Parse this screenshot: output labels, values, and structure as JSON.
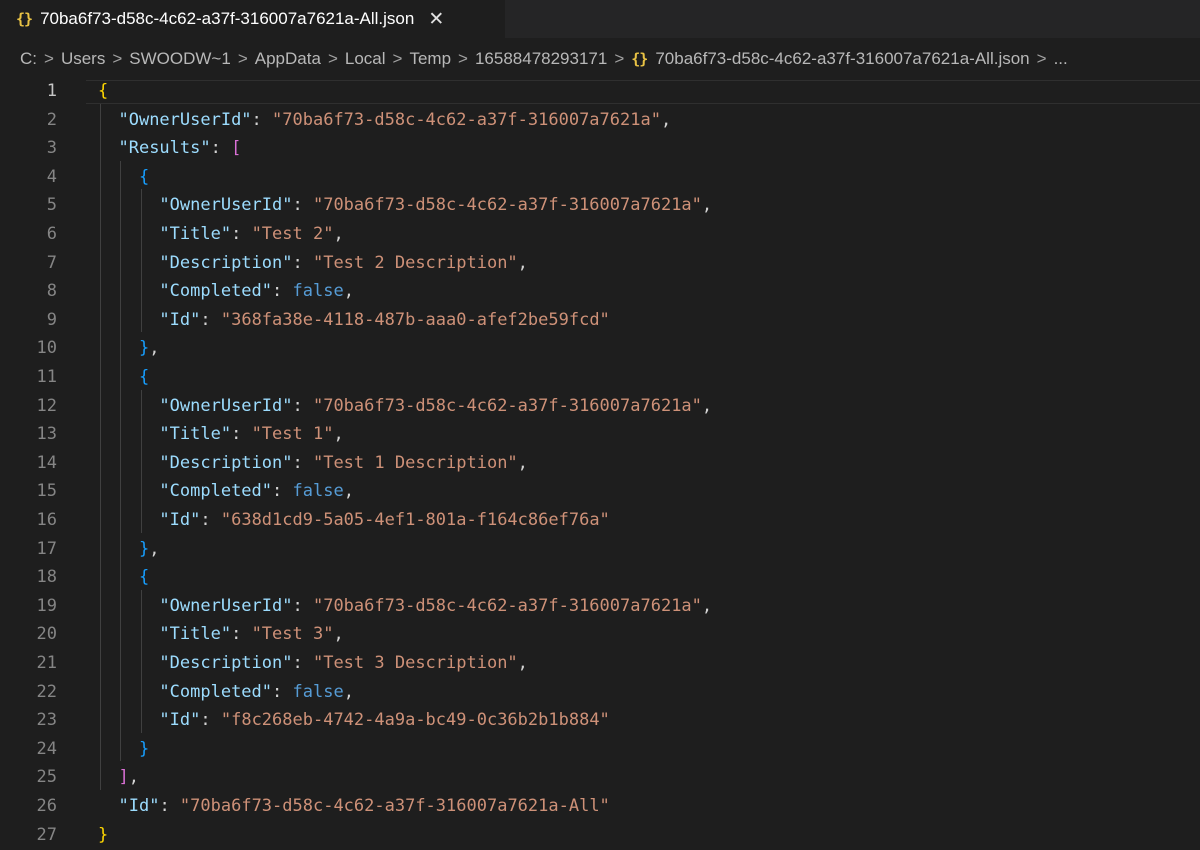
{
  "tab": {
    "icon": "{}",
    "label": "70ba6f73-d58c-4c62-a37f-316007a7621a-All.json",
    "close": "✕"
  },
  "breadcrumb": {
    "parts": [
      "C:",
      "Users",
      "SWOODW~1",
      "AppData",
      "Local",
      "Temp",
      "16588478293171"
    ],
    "file_icon": "{}",
    "file": "70ba6f73-d58c-4c62-a37f-316007a7621a-All.json",
    "ellipsis": "...",
    "separator": ">"
  },
  "editor": {
    "active_line": 1,
    "lines": [
      {
        "n": "1",
        "tokens": [
          {
            "t": "{",
            "c": "br1"
          }
        ]
      },
      {
        "n": "2",
        "tokens": [
          {
            "t": "  "
          },
          {
            "t": "\"OwnerUserId\"",
            "c": "k"
          },
          {
            "t": ": ",
            "c": "p"
          },
          {
            "t": "\"70ba6f73-d58c-4c62-a37f-316007a7621a\"",
            "c": "s"
          },
          {
            "t": ",",
            "c": "p"
          }
        ]
      },
      {
        "n": "3",
        "tokens": [
          {
            "t": "  "
          },
          {
            "t": "\"Results\"",
            "c": "k"
          },
          {
            "t": ": ",
            "c": "p"
          },
          {
            "t": "[",
            "c": "br2"
          }
        ]
      },
      {
        "n": "4",
        "tokens": [
          {
            "t": "    "
          },
          {
            "t": "{",
            "c": "br3"
          }
        ]
      },
      {
        "n": "5",
        "tokens": [
          {
            "t": "      "
          },
          {
            "t": "\"OwnerUserId\"",
            "c": "k"
          },
          {
            "t": ": ",
            "c": "p"
          },
          {
            "t": "\"70ba6f73-d58c-4c62-a37f-316007a7621a\"",
            "c": "s"
          },
          {
            "t": ",",
            "c": "p"
          }
        ]
      },
      {
        "n": "6",
        "tokens": [
          {
            "t": "      "
          },
          {
            "t": "\"Title\"",
            "c": "k"
          },
          {
            "t": ": ",
            "c": "p"
          },
          {
            "t": "\"Test 2\"",
            "c": "s"
          },
          {
            "t": ",",
            "c": "p"
          }
        ]
      },
      {
        "n": "7",
        "tokens": [
          {
            "t": "      "
          },
          {
            "t": "\"Description\"",
            "c": "k"
          },
          {
            "t": ": ",
            "c": "p"
          },
          {
            "t": "\"Test 2 Description\"",
            "c": "s"
          },
          {
            "t": ",",
            "c": "p"
          }
        ]
      },
      {
        "n": "8",
        "tokens": [
          {
            "t": "      "
          },
          {
            "t": "\"Completed\"",
            "c": "k"
          },
          {
            "t": ": ",
            "c": "p"
          },
          {
            "t": "false",
            "c": "b"
          },
          {
            "t": ",",
            "c": "p"
          }
        ]
      },
      {
        "n": "9",
        "tokens": [
          {
            "t": "      "
          },
          {
            "t": "\"Id\"",
            "c": "k"
          },
          {
            "t": ": ",
            "c": "p"
          },
          {
            "t": "\"368fa38e-4118-487b-aaa0-afef2be59fcd\"",
            "c": "s"
          }
        ]
      },
      {
        "n": "10",
        "tokens": [
          {
            "t": "    "
          },
          {
            "t": "}",
            "c": "br3"
          },
          {
            "t": ",",
            "c": "p"
          }
        ]
      },
      {
        "n": "11",
        "tokens": [
          {
            "t": "    "
          },
          {
            "t": "{",
            "c": "br3"
          }
        ]
      },
      {
        "n": "12",
        "tokens": [
          {
            "t": "      "
          },
          {
            "t": "\"OwnerUserId\"",
            "c": "k"
          },
          {
            "t": ": ",
            "c": "p"
          },
          {
            "t": "\"70ba6f73-d58c-4c62-a37f-316007a7621a\"",
            "c": "s"
          },
          {
            "t": ",",
            "c": "p"
          }
        ]
      },
      {
        "n": "13",
        "tokens": [
          {
            "t": "      "
          },
          {
            "t": "\"Title\"",
            "c": "k"
          },
          {
            "t": ": ",
            "c": "p"
          },
          {
            "t": "\"Test 1\"",
            "c": "s"
          },
          {
            "t": ",",
            "c": "p"
          }
        ]
      },
      {
        "n": "14",
        "tokens": [
          {
            "t": "      "
          },
          {
            "t": "\"Description\"",
            "c": "k"
          },
          {
            "t": ": ",
            "c": "p"
          },
          {
            "t": "\"Test 1 Description\"",
            "c": "s"
          },
          {
            "t": ",",
            "c": "p"
          }
        ]
      },
      {
        "n": "15",
        "tokens": [
          {
            "t": "      "
          },
          {
            "t": "\"Completed\"",
            "c": "k"
          },
          {
            "t": ": ",
            "c": "p"
          },
          {
            "t": "false",
            "c": "b"
          },
          {
            "t": ",",
            "c": "p"
          }
        ]
      },
      {
        "n": "16",
        "tokens": [
          {
            "t": "      "
          },
          {
            "t": "\"Id\"",
            "c": "k"
          },
          {
            "t": ": ",
            "c": "p"
          },
          {
            "t": "\"638d1cd9-5a05-4ef1-801a-f164c86ef76a\"",
            "c": "s"
          }
        ]
      },
      {
        "n": "17",
        "tokens": [
          {
            "t": "    "
          },
          {
            "t": "}",
            "c": "br3"
          },
          {
            "t": ",",
            "c": "p"
          }
        ]
      },
      {
        "n": "18",
        "tokens": [
          {
            "t": "    "
          },
          {
            "t": "{",
            "c": "br3"
          }
        ]
      },
      {
        "n": "19",
        "tokens": [
          {
            "t": "      "
          },
          {
            "t": "\"OwnerUserId\"",
            "c": "k"
          },
          {
            "t": ": ",
            "c": "p"
          },
          {
            "t": "\"70ba6f73-d58c-4c62-a37f-316007a7621a\"",
            "c": "s"
          },
          {
            "t": ",",
            "c": "p"
          }
        ]
      },
      {
        "n": "20",
        "tokens": [
          {
            "t": "      "
          },
          {
            "t": "\"Title\"",
            "c": "k"
          },
          {
            "t": ": ",
            "c": "p"
          },
          {
            "t": "\"Test 3\"",
            "c": "s"
          },
          {
            "t": ",",
            "c": "p"
          }
        ]
      },
      {
        "n": "21",
        "tokens": [
          {
            "t": "      "
          },
          {
            "t": "\"Description\"",
            "c": "k"
          },
          {
            "t": ": ",
            "c": "p"
          },
          {
            "t": "\"Test 3 Description\"",
            "c": "s"
          },
          {
            "t": ",",
            "c": "p"
          }
        ]
      },
      {
        "n": "22",
        "tokens": [
          {
            "t": "      "
          },
          {
            "t": "\"Completed\"",
            "c": "k"
          },
          {
            "t": ": ",
            "c": "p"
          },
          {
            "t": "false",
            "c": "b"
          },
          {
            "t": ",",
            "c": "p"
          }
        ]
      },
      {
        "n": "23",
        "tokens": [
          {
            "t": "      "
          },
          {
            "t": "\"Id\"",
            "c": "k"
          },
          {
            "t": ": ",
            "c": "p"
          },
          {
            "t": "\"f8c268eb-4742-4a9a-bc49-0c36b2b1b884\"",
            "c": "s"
          }
        ]
      },
      {
        "n": "24",
        "tokens": [
          {
            "t": "    "
          },
          {
            "t": "}",
            "c": "br3"
          }
        ]
      },
      {
        "n": "25",
        "tokens": [
          {
            "t": "  "
          },
          {
            "t": "]",
            "c": "br2"
          },
          {
            "t": ",",
            "c": "p"
          }
        ]
      },
      {
        "n": "26",
        "tokens": [
          {
            "t": "  "
          },
          {
            "t": "\"Id\"",
            "c": "k"
          },
          {
            "t": ": ",
            "c": "p"
          },
          {
            "t": "\"70ba6f73-d58c-4c62-a37f-316007a7621a-All\"",
            "c": "s"
          }
        ]
      },
      {
        "n": "27",
        "tokens": [
          {
            "t": "}",
            "c": "br1"
          }
        ]
      }
    ]
  },
  "colors": {
    "background": "#1e1e1e",
    "key": "#9cdcfe",
    "string": "#ce9178",
    "boolean": "#569cd6",
    "bracket_level1": "#ffd700",
    "bracket_level2": "#da70d6",
    "bracket_level3": "#179fff"
  }
}
